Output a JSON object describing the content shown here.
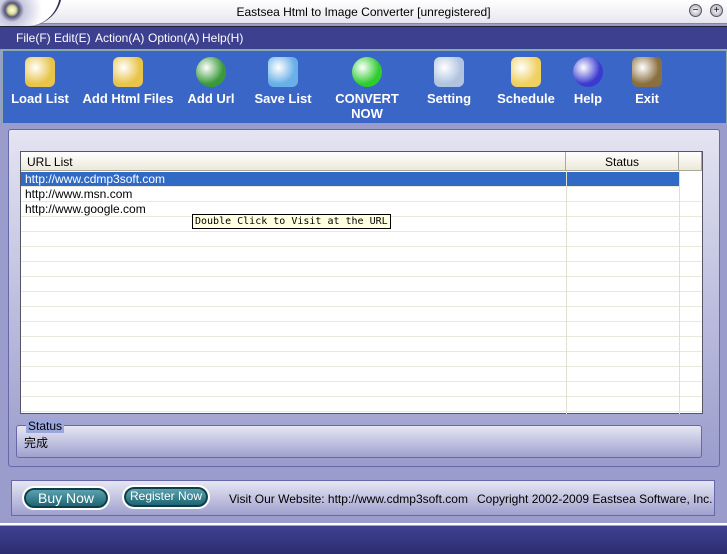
{
  "window": {
    "title": "Eastsea Html to Image Converter [unregistered]"
  },
  "menu": [
    "File(F)",
    "Edit(E)",
    "Action(A)",
    "Option(A)",
    "Help(H)"
  ],
  "toolbar": [
    {
      "label": "Load List",
      "icon": "folder-open-icon",
      "color": "#e8c44a"
    },
    {
      "label": "Add Html Files",
      "icon": "folder-add-icon",
      "color": "#e8c44a"
    },
    {
      "label": "Add Url",
      "icon": "globe-icon",
      "color": "#3a9a3a"
    },
    {
      "label": "Save List",
      "icon": "floppy-disk-icon",
      "color": "#6ab0e8"
    },
    {
      "label": "CONVERT NOW",
      "icon": "play-arrow-icon",
      "color": "#2ecc2e"
    },
    {
      "label": "Setting",
      "icon": "settings-disc-icon",
      "color": "#b0c4e0"
    },
    {
      "label": "Schedule",
      "icon": "alarm-clock-icon",
      "color": "#f0d060"
    },
    {
      "label": "Help",
      "icon": "help-icon",
      "color": "#3a3ad0"
    },
    {
      "label": "Exit",
      "icon": "exit-door-icon",
      "color": "#8a7040"
    }
  ],
  "list": {
    "headers": [
      "URL List",
      "Status"
    ],
    "rows": [
      {
        "url": "http://www.cdmp3soft.com",
        "status": ""
      },
      {
        "url": "http://www.msn.com",
        "status": ""
      },
      {
        "url": "http://www.google.com",
        "status": ""
      }
    ],
    "tooltip": "Double Click to Visit at the URL"
  },
  "status": {
    "label": "Status",
    "value": "完成"
  },
  "footer": {
    "buy": "Buy Now",
    "register": "Register Now",
    "website": "Visit Our Website: http://www.cdmp3soft.com",
    "copyright": "Copyright 2002-2009 Eastsea Software, Inc."
  },
  "colors": {
    "selection": "#316ac5",
    "toolbar": "#3a67c7",
    "menubar": "#3d3f8f"
  }
}
